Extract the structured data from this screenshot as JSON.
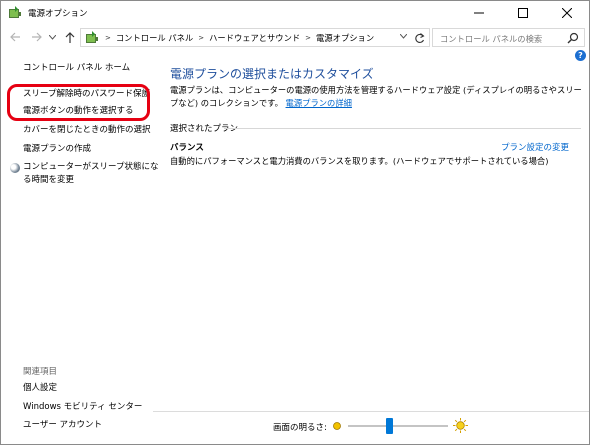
{
  "window": {
    "title": "電源オプション",
    "minimize_glyph": "—",
    "maximize_glyph": "☐",
    "close_glyph": "✕"
  },
  "nav": {
    "back_icon": "arrow-left-icon",
    "forward_icon": "arrow-right-icon",
    "recent_icon": "chevron-down-icon",
    "up_icon": "arrow-up-icon"
  },
  "address": {
    "breadcrumb": [
      "コントロール パネル",
      "ハードウェアとサウンド",
      "電源オプション"
    ],
    "separator": ">"
  },
  "search": {
    "placeholder": "コントロール パネルの検索"
  },
  "sidebar": {
    "home": "コントロール パネル ホーム",
    "links": [
      "スリープ解除時のパスワード保護",
      "電源ボタンの動作を選択する",
      "カバーを閉じたときの動作の選択",
      "電源プランの作成"
    ],
    "sleep_link_line1": "コンピューターがスリープ状態にな",
    "sleep_link_line2": "る時間を変更",
    "related_title": "関連項目",
    "related_links": [
      "個人設定",
      "Windows モビリティ センター",
      "ユーザー アカウント"
    ]
  },
  "main": {
    "heading": "電源プランの選択またはカスタマイズ",
    "description": "電源プランは、コンピューターの電源の使用方法を管理するハードウェア設定 (ディスプレイの明るさやスリープなど) のコレクションです。",
    "description_link": "電源プランの詳細",
    "section_title": "選択されたプラン",
    "plan_name": "バランス",
    "plan_change": "プラン設定の変更",
    "plan_desc": "自動的にパフォーマンスと電力消費のバランスを取ります。(ハードウェアでサポートされている場合)"
  },
  "bottom": {
    "brightness_label": "画面の明るさ:",
    "brightness_level": 0.41
  },
  "colors": {
    "heading": "#1e4e9c",
    "link": "#0066cc",
    "highlight": "#e60012",
    "slider": "#0078d7"
  }
}
